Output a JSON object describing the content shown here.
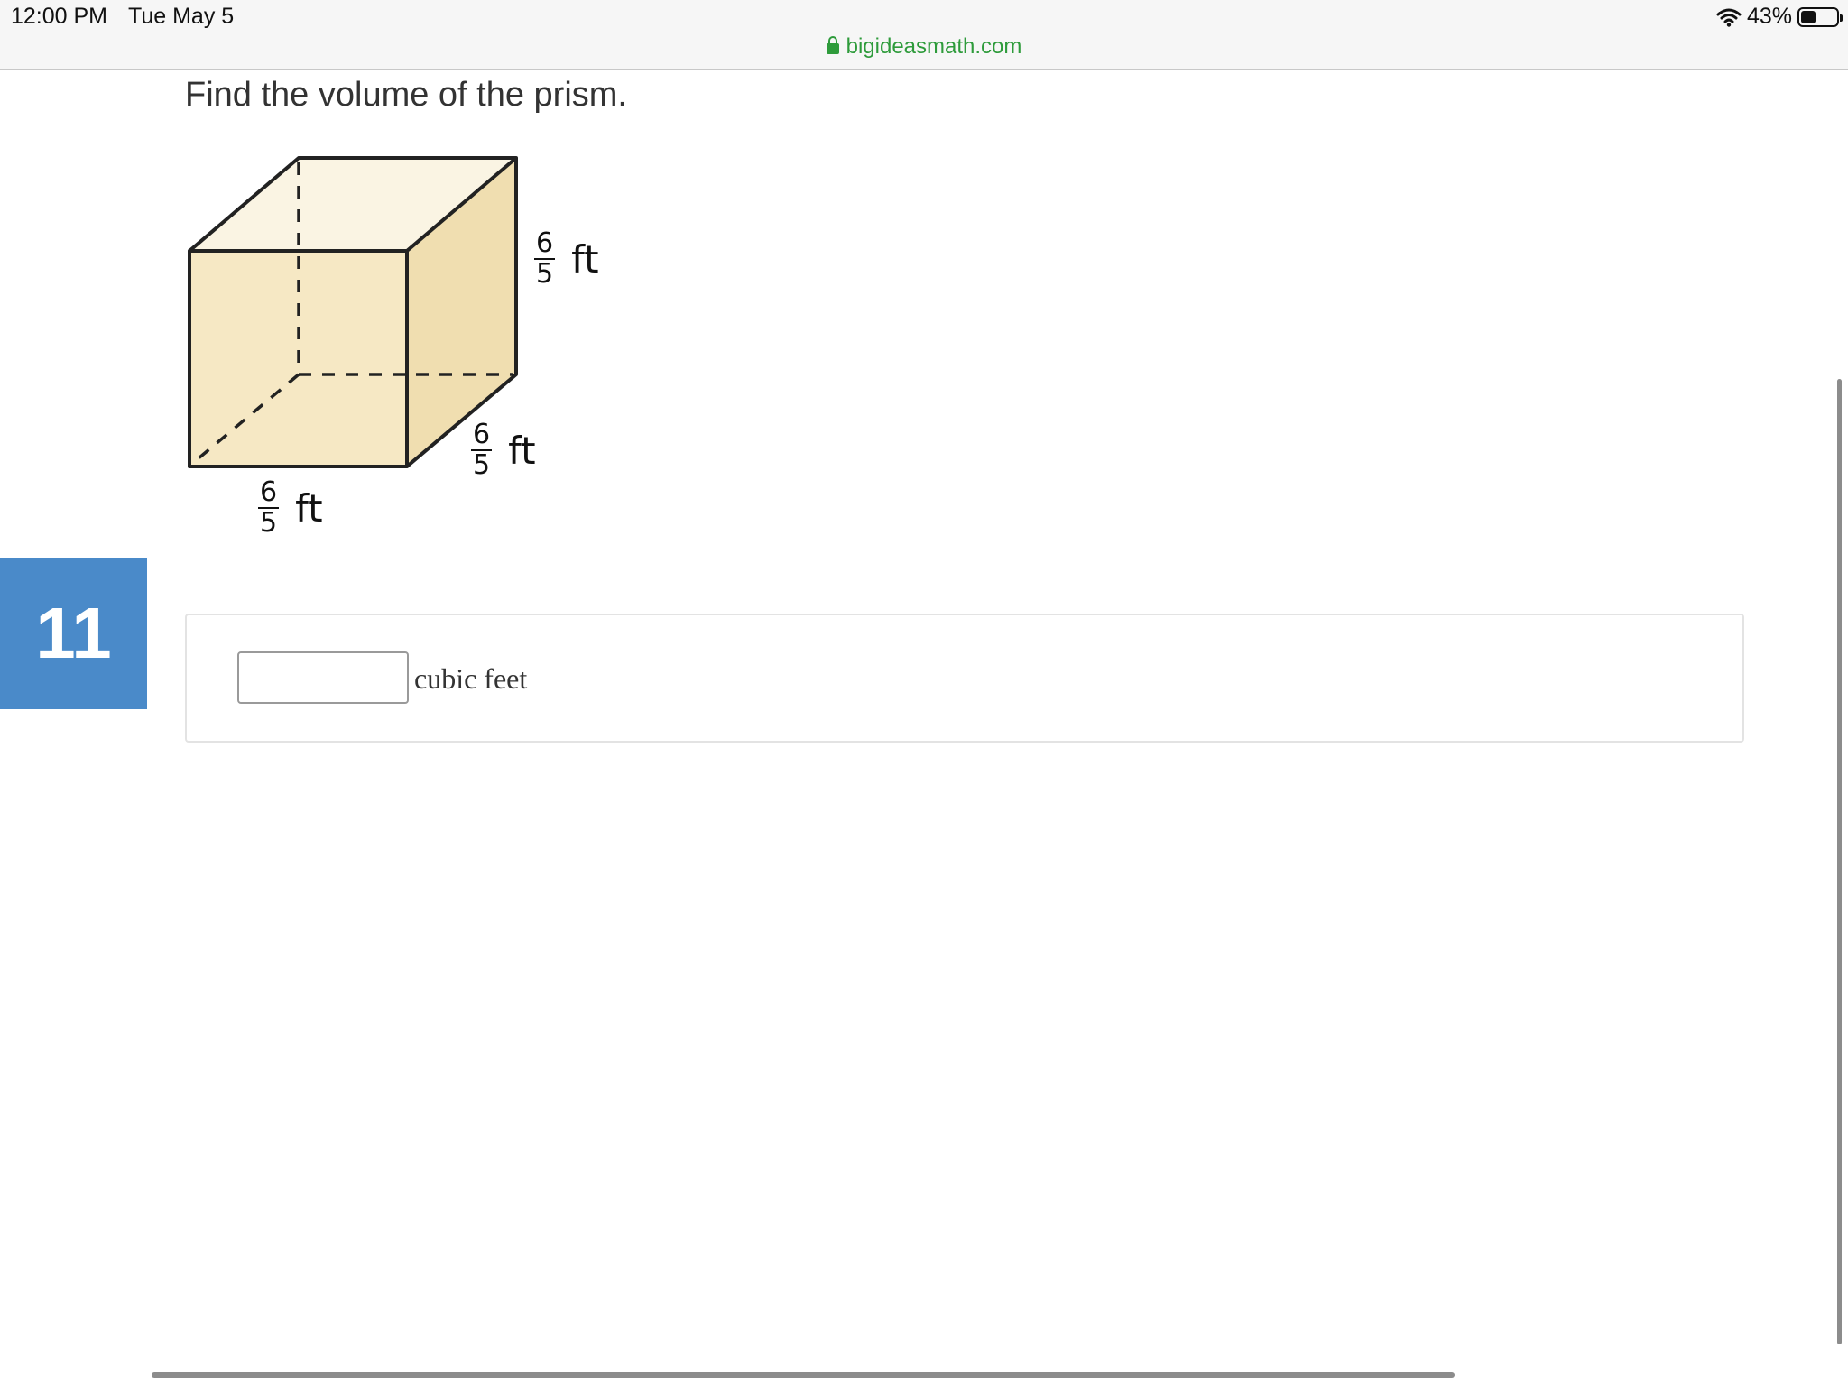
{
  "status_bar": {
    "time": "12:00 PM",
    "date": "Tue May 5",
    "battery": "43%",
    "battery_level": 0.43
  },
  "browser": {
    "url": "bigideasmath.com"
  },
  "question": {
    "prompt": "Find the volume of the prism.",
    "number": "11",
    "dimensions": [
      {
        "numerator": "6",
        "denominator": "5",
        "unit": "ft"
      },
      {
        "numerator": "6",
        "denominator": "5",
        "unit": "ft"
      },
      {
        "numerator": "6",
        "denominator": "5",
        "unit": "ft"
      }
    ]
  },
  "answer": {
    "value": "",
    "unit_label": "cubic feet"
  },
  "colors": {
    "badge": "#4a8ac9",
    "url": "#2e9b3b",
    "prism_front": "#f6e8c4",
    "prism_top": "#faf4e3",
    "prism_side": "#f0deb0"
  }
}
